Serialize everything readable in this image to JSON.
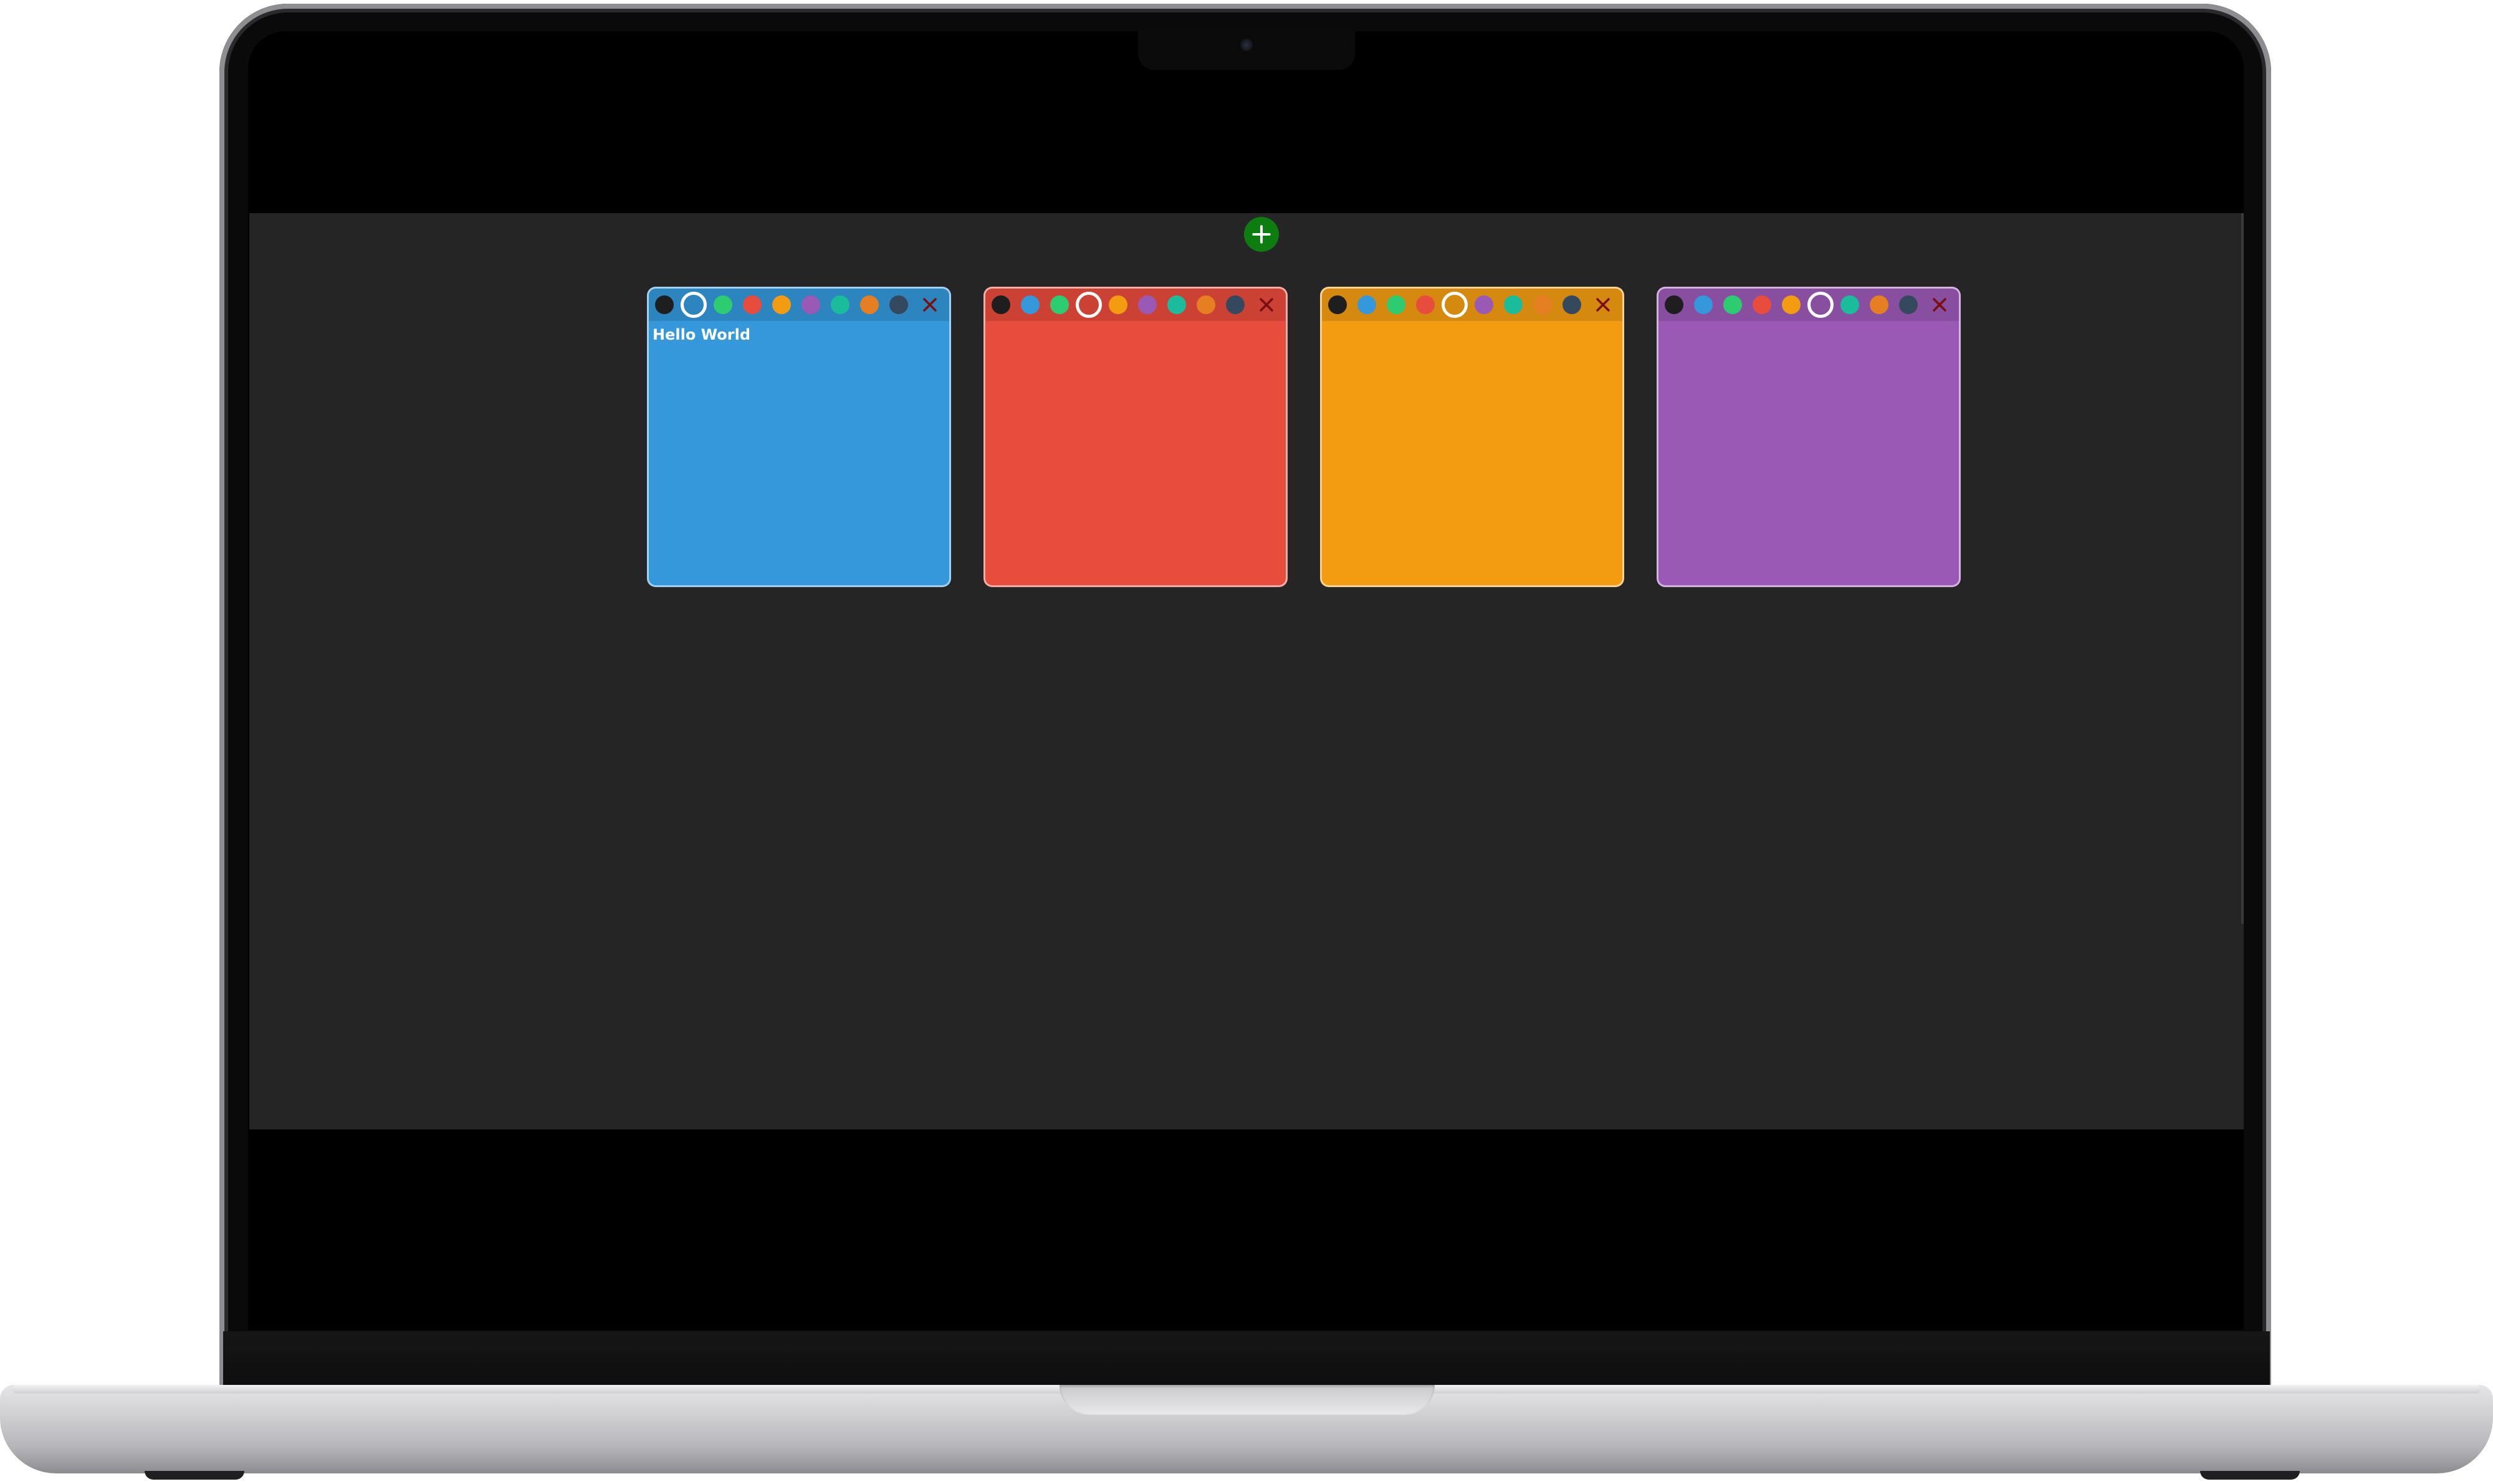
{
  "app": {
    "add_button_icon": "plus-icon",
    "add_button_color": "#0d7d10",
    "background": "#252525"
  },
  "palette": [
    {
      "name": "black",
      "color": "#1e1e1e"
    },
    {
      "name": "blue",
      "color": "#3498db"
    },
    {
      "name": "green",
      "color": "#2ecc71"
    },
    {
      "name": "red",
      "color": "#e74c3c"
    },
    {
      "name": "yellow",
      "color": "#f39c12"
    },
    {
      "name": "purple",
      "color": "#9b59b6"
    },
    {
      "name": "teal",
      "color": "#1abc9c"
    },
    {
      "name": "orange",
      "color": "#e67e22"
    },
    {
      "name": "navy",
      "color": "#34495e"
    }
  ],
  "notes": [
    {
      "color": "#3498db",
      "selected": "blue",
      "text": "Hello World",
      "close_icon": "close-icon"
    },
    {
      "color": "#e74c3c",
      "selected": "red",
      "text": "",
      "close_icon": "close-icon"
    },
    {
      "color": "#f39c12",
      "selected": "yellow",
      "text": "",
      "close_icon": "close-icon"
    },
    {
      "color": "#9b59b6",
      "selected": "purple",
      "text": "",
      "close_icon": "close-icon"
    }
  ]
}
